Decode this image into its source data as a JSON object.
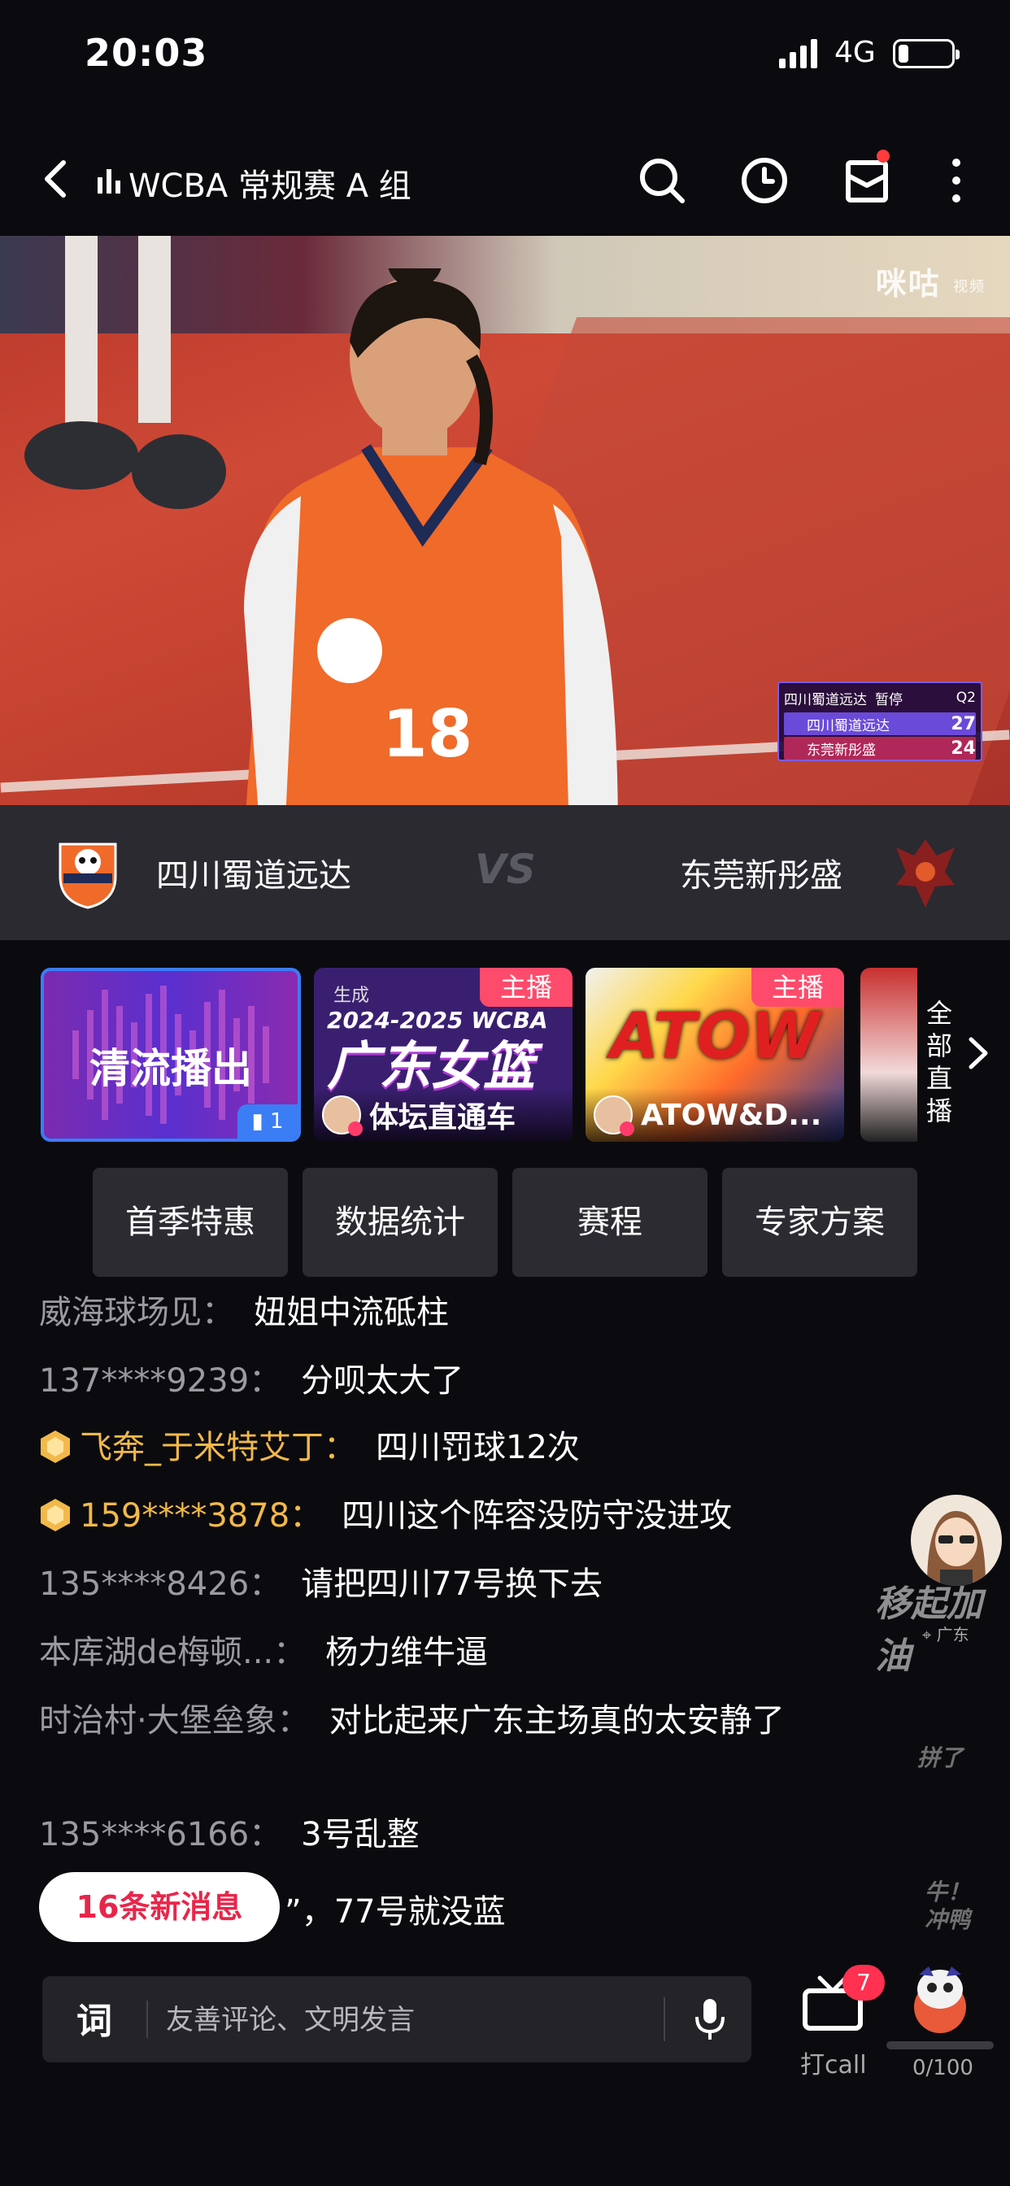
{
  "status": {
    "time": "20:03",
    "network": "4G",
    "battery_level": 0.2
  },
  "header": {
    "title": "WCBA 常规赛 A 组"
  },
  "video": {
    "watermark": "咪咕",
    "watermark_sub": "视频",
    "scoreboard": {
      "home": "四川蜀道远达",
      "status": "暂停",
      "period": "Q2",
      "teams": [
        {
          "name": "四川蜀道远达",
          "score": "27"
        },
        {
          "name": "东莞新彤盛",
          "score": "24"
        }
      ]
    }
  },
  "match": {
    "home_team": "四川蜀道远达",
    "vs": "VS",
    "away_team": "东莞新彤盛"
  },
  "streams": [
    {
      "label": "清流播出",
      "viewers": "1",
      "active": true
    },
    {
      "badge": "主播",
      "name": "体坛直通车",
      "thumb_text": "广东女篮",
      "thumb_sub": "生成",
      "thumb_sub2": "2024-2025 WCBA"
    },
    {
      "badge": "主播",
      "name": "ATOW&D...",
      "thumb_text": "ATOW"
    }
  ],
  "all_live_label": "全部直播",
  "quick_buttons": [
    "首季特惠",
    "数据统计",
    "赛程",
    "专家方案"
  ],
  "comments": [
    {
      "user": "威海球场见：",
      "text": "妞姐中流砥柱",
      "vip": false
    },
    {
      "user": "137****9239：",
      "text": "分呗太大了",
      "vip": false
    },
    {
      "user": "飞奔_于米特艾丁：",
      "text": "四川罚球12次",
      "vip": true
    },
    {
      "user": "159****3878：",
      "text": "四川这个阵容没防守没进攻",
      "vip": true
    },
    {
      "user": "135****8426：",
      "text": "请把四川77号换下去",
      "vip": false
    },
    {
      "user": "本库湖de梅顿...：",
      "text": "杨力维牛逼",
      "vip": false
    },
    {
      "user": "时治村·大堡垒象：",
      "text": "对比起来广东主场真的太安静了",
      "vip": false
    },
    {
      "user": "135****6166：",
      "text": "3号乱整",
      "vip": false
    }
  ],
  "comment_tail": "”，77号就没蓝",
  "new_messages": "16条新消息",
  "floating": {
    "main": "移起加油",
    "location": "广东",
    "small1": "拼了",
    "small2": "牛！冲鸭"
  },
  "input": {
    "placeholder": "友善评论、文明发言"
  },
  "call": {
    "label": "打call",
    "badge": "7"
  },
  "energy": {
    "label": "0/100",
    "value": 0,
    "max": 100
  }
}
